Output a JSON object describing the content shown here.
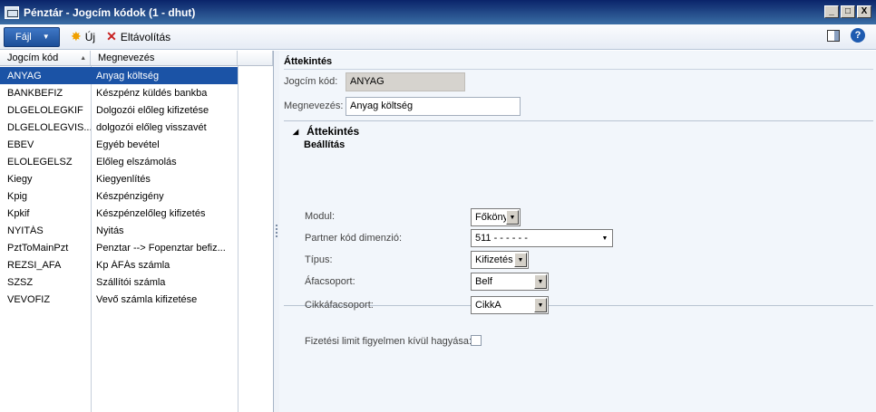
{
  "window": {
    "title": "Pénztár - Jogcím kódok (1 - dhut)",
    "minimize": "_",
    "maximize": "□",
    "close": "X"
  },
  "toolbar": {
    "file_label": "Fájl",
    "new_label": "Új",
    "delete_label": "Eltávolítás",
    "help_glyph": "?"
  },
  "list": {
    "headers": {
      "code": "Jogcím kód",
      "name": "Megnevezés"
    },
    "rows": [
      {
        "code": "ANYAG",
        "name": "Anyag költség"
      },
      {
        "code": "BANKBEFIZ",
        "name": "Készpénz küldés bankba"
      },
      {
        "code": "DLGELOLEGKIF",
        "name": "Dolgozói előleg kifizetése"
      },
      {
        "code": "DLGELOLEGVIS...",
        "name": "dolgozói előleg visszavét"
      },
      {
        "code": "EBEV",
        "name": "Egyéb bevétel"
      },
      {
        "code": "ELOLEGELSZ",
        "name": "Előleg elszámolás"
      },
      {
        "code": "Kiegy",
        "name": "Kiegyenlítés"
      },
      {
        "code": "Kpig",
        "name": "Készpénzigény"
      },
      {
        "code": "Kpkif",
        "name": "Készpénzelőleg kifizetés"
      },
      {
        "code": "NYITÁS",
        "name": "Nyitás"
      },
      {
        "code": "PztToMainPzt",
        "name": "Penztar --> Fopenztar befiz..."
      },
      {
        "code": "REZSI_AFA",
        "name": "Kp ÁFÁs számla"
      },
      {
        "code": "SZSZ",
        "name": "Szállítói számla"
      },
      {
        "code": "VEVOFIZ",
        "name": "Vevő számla kifizetése"
      }
    ]
  },
  "panel": {
    "section_title": "Áttekintés",
    "code_label": "Jogcím kód:",
    "code_value": "ANYAG",
    "name_label": "Megnevezés:",
    "name_value": "Anyag költség",
    "sub_title": "Áttekintés",
    "sub_subtitle": "Beállítás",
    "modul_label": "Modul:",
    "modul_value": "Főkönyv",
    "partner_label": "Partner kód dimenzió:",
    "partner_value": "511 -      -      -      -      -      -",
    "tipus_label": "Típus:",
    "tipus_value": "Kifizetés",
    "afa_label": "Áfacsoport:",
    "afa_value": "Belf",
    "cikkafa_label": "Cikkáfacsoport:",
    "cikkafa_value": "CikkA",
    "limit_label": "Fizetési limit figyelmen kívül hagyása:"
  }
}
